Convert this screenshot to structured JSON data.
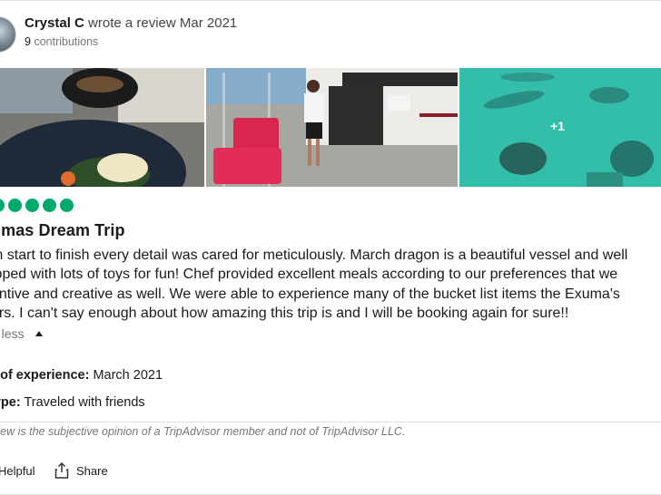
{
  "review": {
    "reviewer_name": "Crystal C",
    "wrote_text": "wrote a review Mar 2021",
    "contributions_count": "9",
    "contributions_label": "contributions",
    "photos": {
      "more_count": "+1"
    },
    "rating_bubbles": 5,
    "title": "umas Dream Trip",
    "body_lines": [
      "m start to finish every detail was cared for meticulously. March dragon is a beautiful vessel and well",
      "ipped with lots of toys for fun! Chef provided excellent meals according to our preferences that we",
      "entive and creative as well. We were able to experience many of the bucket list items the Exuma's",
      "ers. I can't say enough about how amazing this trip is and I will be booking again for sure!!"
    ],
    "read_less_label": "d less",
    "date_of_experience_label": "e of experience:",
    "date_of_experience_value": "March 2021",
    "trip_type_label": "type:",
    "trip_type_value": "Traveled with friends",
    "disclaimer": "review is the subjective opinion of a TripAdvisor member and not of TripAdvisor LLC.",
    "helpful_label": "Helpful",
    "share_label": "Share"
  },
  "colors": {
    "bubble_green": "#00aa6c",
    "muted_text": "#767676"
  }
}
